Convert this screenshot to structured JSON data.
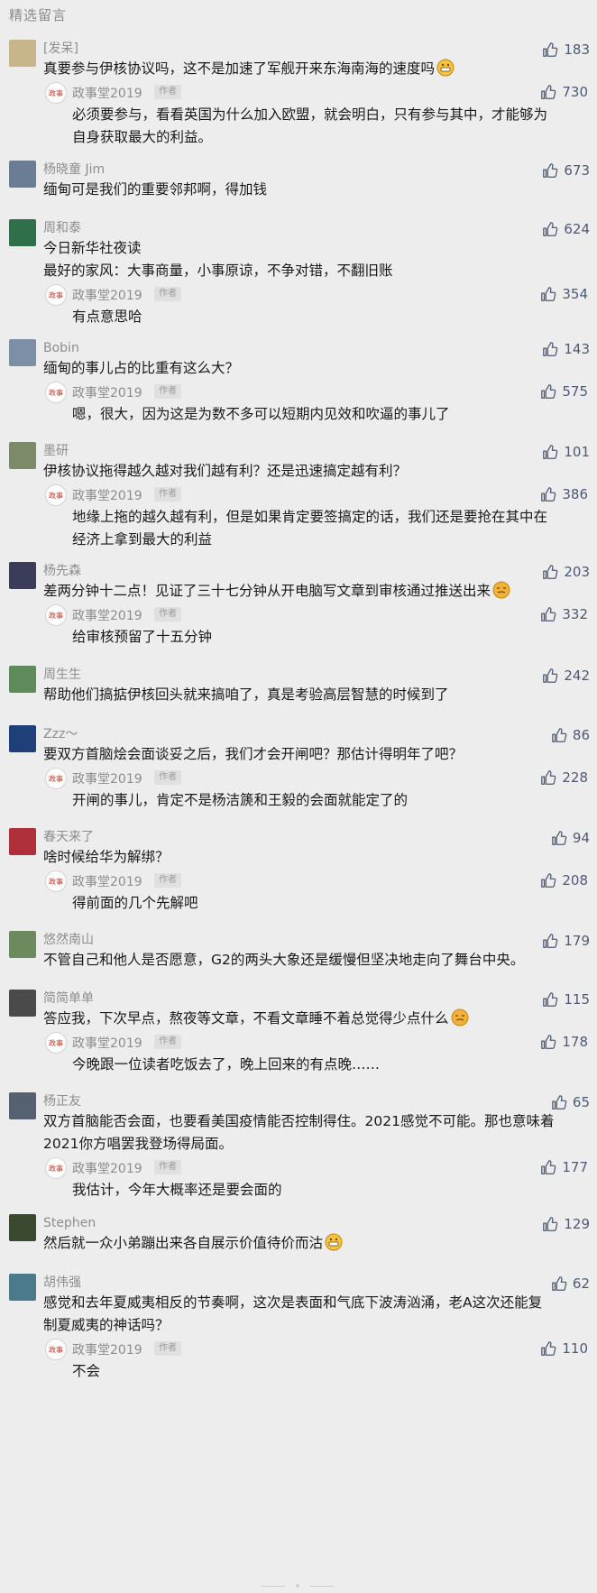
{
  "section_title": "精选留言",
  "author_badge": "作者",
  "comments": [
    {
      "nick": "[发呆]",
      "text": "真要参与伊核协议吗，这不是加速了军舰开来东海南海的速度吗",
      "emoji": "grin",
      "likes": "183",
      "avatar_color": "#c9b58a",
      "reply": {
        "name": "政事堂2019",
        "text": "必须要参与，看看英国为什么加入欧盟，就会明白，只有参与其中，才能够为\n自身获取最大的利益。",
        "likes": "730"
      }
    },
    {
      "nick": "杨晓童 Jim",
      "text": "缅甸可是我们的重要邻邦啊，得加钱",
      "likes": "673",
      "avatar_color": "#6a7d95",
      "reply": null
    },
    {
      "nick": "周和泰",
      "text": "今日新华社夜读\n最好的家风：大事商量，小事原谅，不争对错，不翻旧账",
      "likes": "624",
      "avatar_color": "#2f6f4a",
      "reply": {
        "name": "政事堂2019",
        "text": "有点意思哈",
        "likes": "354"
      }
    },
    {
      "nick": "Bobin",
      "text": "缅甸的事儿占的比重有这么大？",
      "likes": "143",
      "avatar_color": "#7c8fa6",
      "reply": {
        "name": "政事堂2019",
        "text": "嗯，很大，因为这是为数不多可以短期内见效和吹逼的事儿了",
        "likes": "575"
      }
    },
    {
      "nick": "墨研",
      "text": "伊核协议拖得越久越对我们越有利？还是迅速搞定越有利？",
      "likes": "101",
      "avatar_color": "#7d8a6a",
      "reply": {
        "name": "政事堂2019",
        "text": "地缘上拖的越久越有利，但是如果肯定要签搞定的话，我们还是要抢在其中在\n经济上拿到最大的利益",
        "likes": "386"
      }
    },
    {
      "nick": "杨先森",
      "text": "差两分钟十二点！见证了三十七分钟从开电脑写文章到审核通过推送出来",
      "emoji": "sweat",
      "likes": "203",
      "avatar_color": "#3b3b5a",
      "reply": {
        "name": "政事堂2019",
        "text": "给审核预留了十五分钟",
        "likes": "332"
      }
    },
    {
      "nick": "周生生",
      "text": "帮助他们搞掂伊核回头就来搞咱了，真是考验高层智慧的时候到了",
      "likes": "242",
      "avatar_color": "#5f8a5a",
      "reply": null
    },
    {
      "nick": "Zzz～",
      "text": "要双方首脑烩会面谈妥之后，我们才会开闸吧？那估计得明年了吧？",
      "likes": "86",
      "avatar_color": "#1f3f7a",
      "reply": {
        "name": "政事堂2019",
        "text": "开闸的事儿，肯定不是杨洁篪和王毅的会面就能定了的",
        "likes": "228"
      }
    },
    {
      "nick": "春天来了",
      "text": "啥时候给华为解绑？",
      "likes": "94",
      "avatar_color": "#b0303a",
      "reply": {
        "name": "政事堂2019",
        "text": "得前面的几个先解吧",
        "likes": "208"
      }
    },
    {
      "nick": "悠然南山",
      "text": "不管自己和他人是否愿意，G2的两头大象还是缓慢但坚决地走向了舞台中央。",
      "likes": "179",
      "avatar_color": "#6d8a5f",
      "reply": null
    },
    {
      "nick": "简简单单",
      "text": "答应我，下次早点，熬夜等文章，不看文章睡不着总觉得少点什么",
      "emoji": "sweat",
      "likes": "115",
      "avatar_color": "#4a4a4a",
      "reply": {
        "name": "政事堂2019",
        "text": "今晚跟一位读者吃饭去了，晚上回来的有点晚……",
        "likes": "178"
      }
    },
    {
      "nick": "杨正友",
      "text": "双方首脑能否会面，也要看美国疫情能否控制得住。2021感觉不可能。那也意味着\n2021你方唱罢我登场得局面。",
      "likes": "65",
      "avatar_color": "#556070",
      "reply": {
        "name": "政事堂2019",
        "text": "我估计，今年大概率还是要会面的",
        "likes": "177"
      }
    },
    {
      "nick": "Stephen",
      "text": "然后就一众小弟蹦出来各自展示价值待价而沽",
      "emoji": "grin",
      "likes": "129",
      "avatar_color": "#3a4a30",
      "reply": null
    },
    {
      "nick": "胡伟强",
      "text": "感觉和去年夏威夷相反的节奏啊，这次是表面和气底下波涛汹涌，老A这次还能复\n制夏威夷的神话吗？",
      "likes": "62",
      "avatar_color": "#4b7a8a",
      "reply": {
        "name": "政事堂2019",
        "text": "不会",
        "likes": "110"
      }
    }
  ],
  "colors": {
    "background": "#ededed",
    "like": "#4d5a73",
    "nick": "#8d8d8d"
  }
}
